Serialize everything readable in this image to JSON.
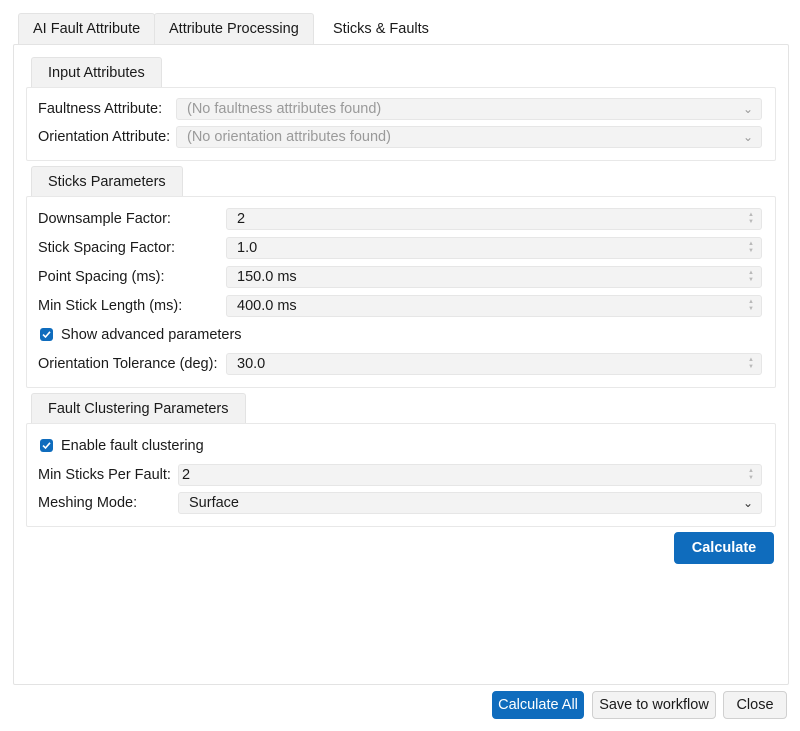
{
  "tabs": [
    {
      "label": "AI Fault Attribute",
      "active": false
    },
    {
      "label": "Attribute Processing",
      "active": false
    },
    {
      "label": "Sticks & Faults",
      "active": true
    }
  ],
  "input_attributes": {
    "title": "Input Attributes",
    "faultness_label": "Faultness Attribute:",
    "faultness_value": "(No faultness attributes found)",
    "orientation_label": "Orientation Attribute:",
    "orientation_value": "(No orientation attributes found)"
  },
  "sticks_parameters": {
    "title": "Sticks Parameters",
    "downsample_label": "Downsample Factor:",
    "downsample_value": "2",
    "stick_spacing_label": "Stick Spacing Factor:",
    "stick_spacing_value": "1.0",
    "point_spacing_label": "Point Spacing (ms):",
    "point_spacing_value": "150.0 ms",
    "min_stick_length_label": "Min Stick Length (ms):",
    "min_stick_length_value": "400.0 ms",
    "show_advanced_label": "Show advanced parameters",
    "show_advanced_checked": true,
    "orientation_tol_label": "Orientation Tolerance (deg):",
    "orientation_tol_value": "30.0"
  },
  "fault_clustering": {
    "title": "Fault Clustering Parameters",
    "enable_label": "Enable fault clustering",
    "enable_checked": true,
    "min_sticks_label": "Min Sticks Per Fault:",
    "min_sticks_value": "2",
    "meshing_label": "Meshing Mode:",
    "meshing_value": "Surface"
  },
  "buttons": {
    "calculate": "Calculate",
    "calculate_all": "Calculate All",
    "save_workflow": "Save to workflow",
    "close": "Close"
  },
  "colors": {
    "accent": "#0f6cbd"
  }
}
